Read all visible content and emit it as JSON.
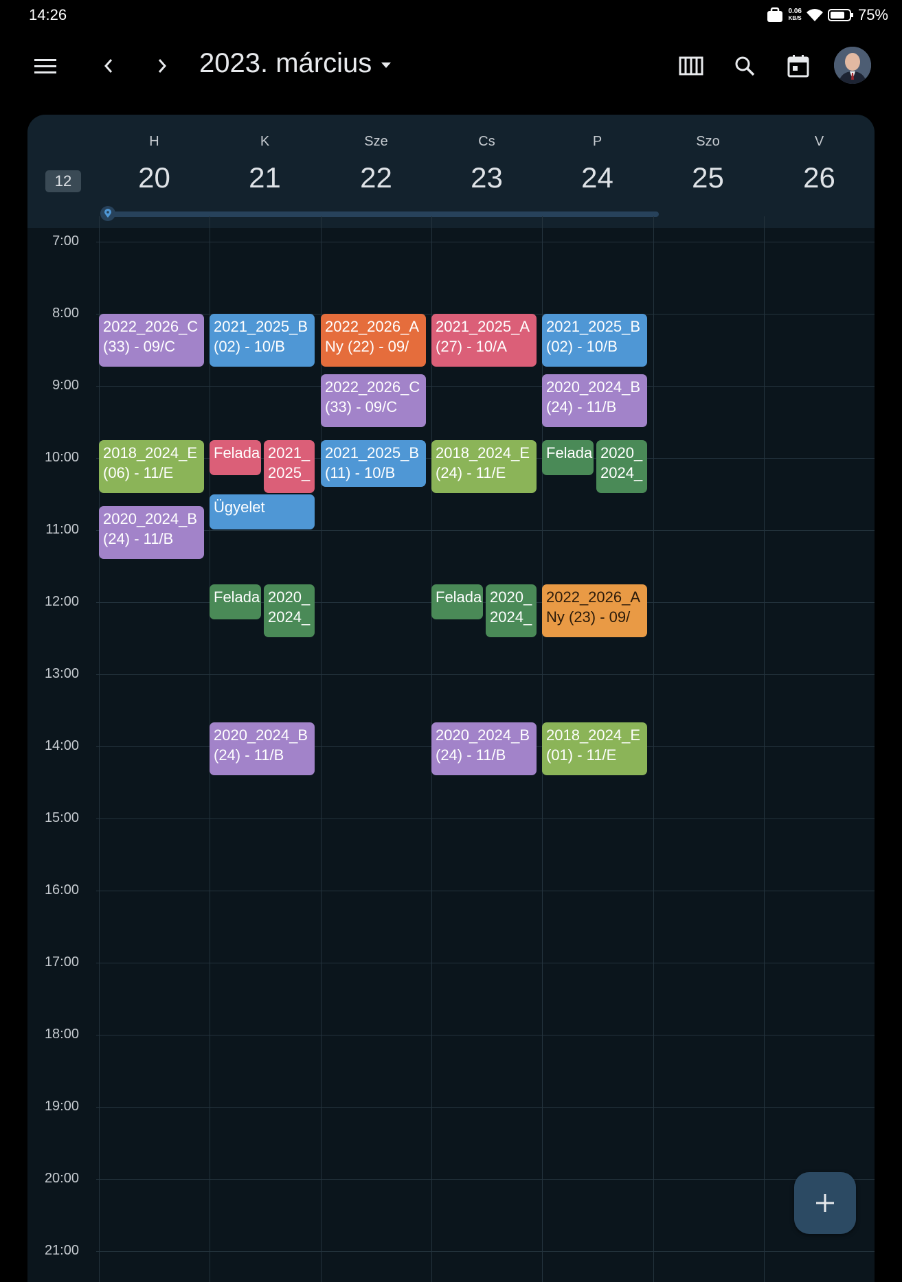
{
  "status": {
    "time": "14:26",
    "net_speed_value": "0.06",
    "net_speed_unit": "KB/S",
    "battery": "75%"
  },
  "header": {
    "title": "2023. március"
  },
  "week": {
    "number": "12",
    "days": [
      {
        "name": "H",
        "num": "20"
      },
      {
        "name": "K",
        "num": "21"
      },
      {
        "name": "Sze",
        "num": "22"
      },
      {
        "name": "Cs",
        "num": "23"
      },
      {
        "name": "P",
        "num": "24"
      },
      {
        "name": "Szo",
        "num": "25"
      },
      {
        "name": "V",
        "num": "26"
      }
    ],
    "week_progress": 0.71
  },
  "hours": [
    "7:00",
    "8:00",
    "9:00",
    "10:00",
    "11:00",
    "12:00",
    "13:00",
    "14:00",
    "15:00",
    "16:00",
    "17:00",
    "18:00",
    "19:00",
    "20:00",
    "21:00"
  ],
  "colors": {
    "purple": "#a283c9",
    "blue": "#4f97d5",
    "orange": "#e56d3c",
    "red": "#db5f78",
    "green": "#8bb458",
    "darkgreen": "#4a8a57",
    "amber": "#e99a45"
  },
  "events": [
    {
      "day": 0,
      "start": "8:00",
      "end": "8:45",
      "color": "purple",
      "lines": [
        "2022_2026_C",
        "(33) - 09/C"
      ]
    },
    {
      "day": 0,
      "start": "9:45",
      "end": "10:30",
      "color": "green",
      "lines": [
        "2018_2024_E",
        "(06) - 11/E"
      ]
    },
    {
      "day": 0,
      "start": "10:40",
      "end": "11:25",
      "color": "purple",
      "lines": [
        "2020_2024_B",
        "(24) - 11/B"
      ]
    },
    {
      "day": 1,
      "start": "8:00",
      "end": "8:45",
      "color": "blue",
      "lines": [
        "2021_2025_B",
        "(02) - 10/B"
      ]
    },
    {
      "day": 1,
      "start": "9:45",
      "end": "10:15",
      "color": "red",
      "half": "left",
      "lines": [
        "Felada"
      ]
    },
    {
      "day": 1,
      "start": "9:45",
      "end": "10:30",
      "color": "red",
      "half": "right",
      "lines": [
        "2021_",
        "2025_"
      ]
    },
    {
      "day": 1,
      "start": "10:30",
      "end": "11:00",
      "color": "blue",
      "lines": [
        "Ügyelet"
      ]
    },
    {
      "day": 1,
      "start": "11:45",
      "end": "12:15",
      "color": "darkgreen",
      "half": "left",
      "lines": [
        "Felada"
      ]
    },
    {
      "day": 1,
      "start": "11:45",
      "end": "12:30",
      "color": "darkgreen",
      "half": "right",
      "lines": [
        "2020_",
        "2024_"
      ]
    },
    {
      "day": 1,
      "start": "13:40",
      "end": "14:25",
      "color": "purple",
      "lines": [
        "2020_2024_B",
        "(24) - 11/B"
      ]
    },
    {
      "day": 2,
      "start": "8:00",
      "end": "8:45",
      "color": "orange",
      "lines": [
        "2022_2026_A",
        "Ny (22) - 09/"
      ]
    },
    {
      "day": 2,
      "start": "8:50",
      "end": "9:35",
      "color": "purple",
      "lines": [
        "2022_2026_C",
        "(33) - 09/C"
      ]
    },
    {
      "day": 2,
      "start": "9:45",
      "end": "10:25",
      "color": "blue",
      "lines": [
        "2021_2025_B",
        "(11) - 10/B"
      ]
    },
    {
      "day": 3,
      "start": "8:00",
      "end": "8:45",
      "color": "red",
      "lines": [
        "2021_2025_A",
        "(27) - 10/A"
      ]
    },
    {
      "day": 3,
      "start": "9:45",
      "end": "10:30",
      "color": "green",
      "lines": [
        "2018_2024_E",
        "(24) - 11/E"
      ]
    },
    {
      "day": 3,
      "start": "11:45",
      "end": "12:15",
      "color": "darkgreen",
      "half": "left",
      "lines": [
        "Felada"
      ]
    },
    {
      "day": 3,
      "start": "11:45",
      "end": "12:30",
      "color": "darkgreen",
      "half": "right",
      "lines": [
        "2020_",
        "2024_"
      ]
    },
    {
      "day": 3,
      "start": "13:40",
      "end": "14:25",
      "color": "purple",
      "lines": [
        "2020_2024_B",
        "(24) - 11/B"
      ]
    },
    {
      "day": 4,
      "start": "8:00",
      "end": "8:45",
      "color": "blue",
      "lines": [
        "2021_2025_B",
        "(02) - 10/B"
      ]
    },
    {
      "day": 4,
      "start": "8:50",
      "end": "9:35",
      "color": "purple",
      "lines": [
        "2020_2024_B",
        "(24) - 11/B"
      ]
    },
    {
      "day": 4,
      "start": "9:45",
      "end": "10:15",
      "color": "darkgreen",
      "half": "left",
      "lines": [
        "Felada"
      ]
    },
    {
      "day": 4,
      "start": "9:45",
      "end": "10:30",
      "color": "darkgreen",
      "half": "right",
      "lines": [
        "2020_",
        "2024_"
      ]
    },
    {
      "day": 4,
      "start": "11:45",
      "end": "12:30",
      "color": "amber",
      "lines": [
        "2022_2026_A",
        "Ny (23) - 09/"
      ]
    },
    {
      "day": 4,
      "start": "13:40",
      "end": "14:25",
      "color": "green",
      "lines": [
        "2018_2024_E",
        "(01) - 11/E"
      ]
    }
  ]
}
